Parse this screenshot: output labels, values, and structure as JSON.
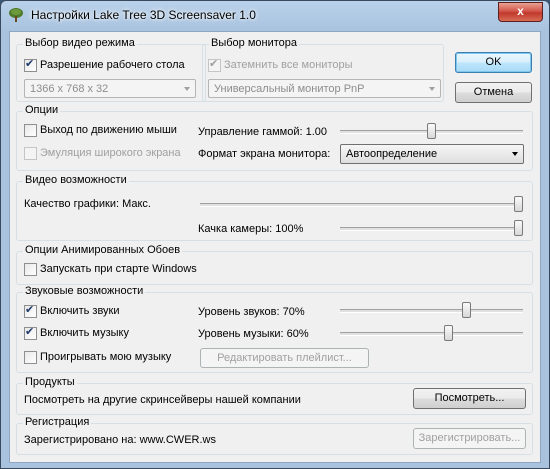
{
  "window": {
    "title": "Настройки Lake Tree 3D Screensaver 1.0",
    "close_label": "x",
    "icon": "tree-icon"
  },
  "video_mode": {
    "title": "Выбор видео режима",
    "desktop_resolution_label": "Разрешение рабочего стола",
    "desktop_resolution_checked": true,
    "resolution_value": "1366 x 768 x 32"
  },
  "monitor": {
    "title": "Выбор монитора",
    "dim_all_label": "Затемнить все мониторы",
    "dim_all_checked": true,
    "monitor_value": "Универсальный монитор PnP"
  },
  "buttons": {
    "ok": "OK",
    "cancel": "Отмена"
  },
  "options": {
    "title": "Опции",
    "exit_mouse_label": "Выход по движению мыши",
    "exit_mouse_checked": false,
    "widescreen_label": "Эмуляция широкого экрана",
    "widescreen_checked": false,
    "gamma_label": "Управление гаммой: 1.00",
    "gamma_level": 0.5,
    "aspect_label": "Формат экрана монитора:",
    "aspect_value": "Автоопределение"
  },
  "video": {
    "title": "Видео возможности",
    "quality_label": "Качество графики: Макс.",
    "quality_level": 1.0,
    "camera_label": "Качка камеры: 100%",
    "camera_level": 1.0
  },
  "wallpaper": {
    "title": "Опции Анимированных Обоев",
    "startup_label": "Запускать при старте Windows",
    "startup_checked": false
  },
  "sound": {
    "title": "Звуковые возможности",
    "sounds_label": "Включить звуки",
    "sounds_checked": true,
    "music_label": "Включить музыку",
    "music_checked": true,
    "my_music_label": "Проигрывать мою музыку",
    "my_music_checked": false,
    "sound_level_label": "Уровень звуков: 70%",
    "sound_level": 0.7,
    "music_level_label": "Уровень музыки: 60%",
    "music_level": 0.6,
    "edit_playlist": "Редактировать плейлист..."
  },
  "products": {
    "title": "Продукты",
    "text": "Посмотреть на другие скринсейверы нашей компании",
    "view_button": "Посмотреть..."
  },
  "registration": {
    "title": "Регистрация",
    "text": "Зарегистрировано на: www.CWER.ws",
    "register_button": "Зарегистрировать..."
  }
}
